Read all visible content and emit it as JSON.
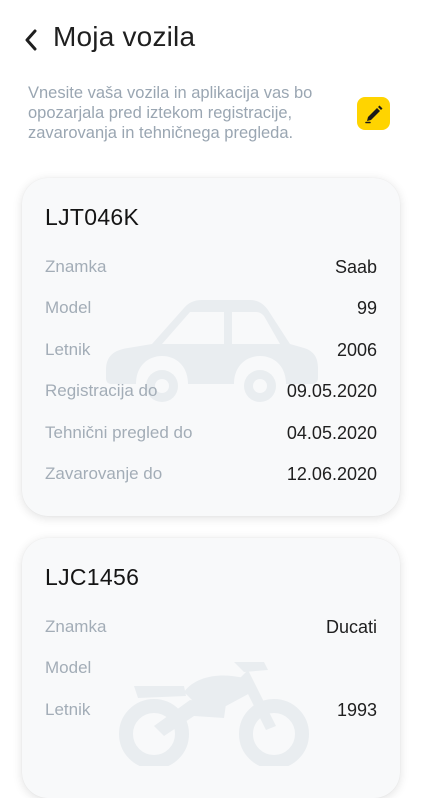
{
  "header": {
    "title": "Moja vozila"
  },
  "intro": {
    "text": "Vnesite vaša vozila in aplikacija vas bo opozarjala pred iztekom registracije, zavarovanja in tehničnega pregleda."
  },
  "icons": {
    "back": "chevron-left-icon",
    "edit": "pencil-icon",
    "car": "car-icon",
    "motorcycle": "motorcycle-icon"
  },
  "colors": {
    "accent": "#ffd400",
    "label": "#a3adb7",
    "value": "#1f1f1f",
    "card": "#f8f9fa"
  },
  "vehicles": [
    {
      "plate": "LJT046K",
      "fields": [
        {
          "label": "Znamka",
          "value": "Saab"
        },
        {
          "label": "Model",
          "value": "99"
        },
        {
          "label": "Letnik",
          "value": "2006"
        },
        {
          "label": "Registracija do",
          "value": "09.05.2020"
        },
        {
          "label": "Tehnični pregled do",
          "value": "04.05.2020"
        },
        {
          "label": "Zavarovanje do",
          "value": "12.06.2020"
        }
      ]
    },
    {
      "plate": "LJC1456",
      "fields": [
        {
          "label": "Znamka",
          "value": "Ducati"
        },
        {
          "label": "Model",
          "value": ""
        },
        {
          "label": "Letnik",
          "value": "1993"
        }
      ]
    }
  ]
}
